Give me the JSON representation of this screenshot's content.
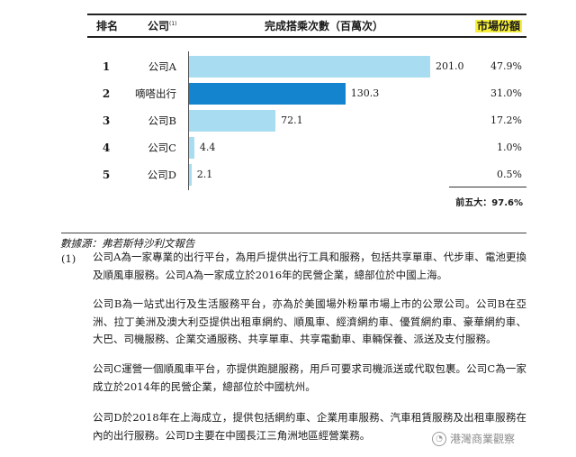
{
  "header": {
    "rank": "排名",
    "company": "公司",
    "company_sup": "(1)",
    "rides": "完成搭乘次數（百萬次）",
    "share": "市場份額"
  },
  "rows": [
    {
      "rank": "1",
      "company": "公司A",
      "value_label": "201.0",
      "share": "47.9%",
      "highlight": false
    },
    {
      "rank": "2",
      "company": "嘀嗒出行",
      "value_label": "130.3",
      "share": "31.0%",
      "highlight": true
    },
    {
      "rank": "3",
      "company": "公司B",
      "value_label": "72.1",
      "share": "17.2%",
      "highlight": false
    },
    {
      "rank": "4",
      "company": "公司C",
      "value_label": "4.4",
      "share": "1.0%",
      "highlight": false
    },
    {
      "rank": "5",
      "company": "公司D",
      "value_label": "2.1",
      "share": "0.5%",
      "highlight": false
    }
  ],
  "chart_data": {
    "type": "bar",
    "orientation": "horizontal",
    "categories": [
      "公司A",
      "嘀嗒出行",
      "公司B",
      "公司C",
      "公司D"
    ],
    "values": [
      201.0,
      130.3,
      72.1,
      4.4,
      2.1
    ],
    "shares": [
      "47.9%",
      "31.0%",
      "17.2%",
      "1.0%",
      "0.5%"
    ],
    "colors": {
      "default": "#a7dcf1",
      "highlight": "#1584cf"
    }
  },
  "total": "前五大：97.6%",
  "source": "數據源：弗若斯特沙利文報告",
  "note_number": "(1)",
  "notes": [
    "公司A為一家專業的出行平台，為用戶提供出行工具和服務，包括共享單車、代步車、電池更換及順風車服務。公司A為一家成立於2016年的民營企業，總部位於中國上海。",
    "公司B為一站式出行及生活服務平台，亦為於美國場外粉單市場上市的公眾公司。公司B在亞洲、拉丁美洲及澳大利亞提供出租車網約、順風車、經濟網約車、優質網約車、豪華網約車、大巴、司機服務、企業交通服務、共享單車、共享電動車、車輛保養、派送及支付服務。",
    "公司C運營一個順風車平台，亦提供跑腿服務，用戶可要求司機派送或代取包裹。公司C為一家成立於2014年的民營企業，總部位於中國杭州。",
    "公司D於2018年在上海成立，提供包括網約車、企業用車服務、汽車租賃服務及出租車服務在內的出行服務。公司D主要在中國長江三角洲地區經營業務。"
  ],
  "watermark": "港灣商業觀察"
}
